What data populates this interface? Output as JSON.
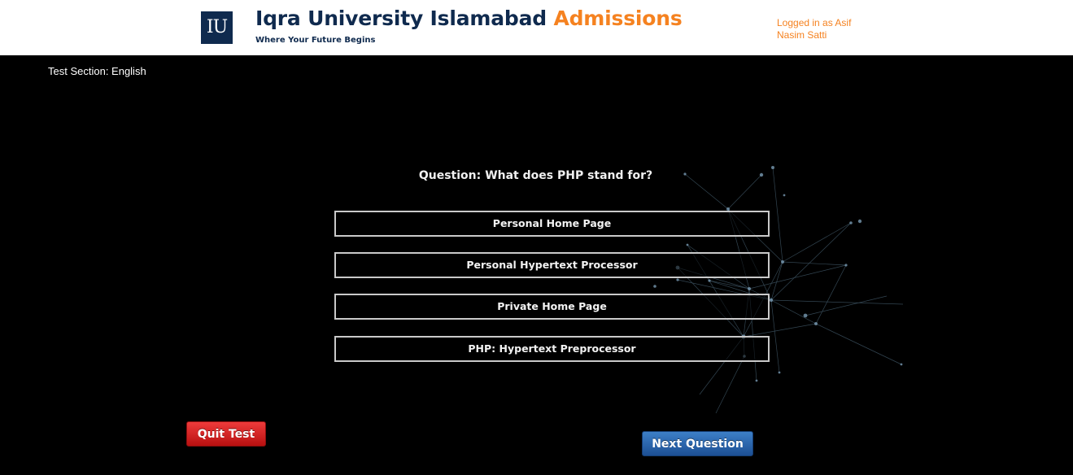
{
  "header": {
    "logo_text": "IU",
    "title_main": "Iqra University Islamabad",
    "title_accent": "Admissions",
    "tagline": "Where Your Future Begins",
    "login_status": "Logged in as Asif Nasim Satti"
  },
  "test": {
    "section_label": "Test Section: English",
    "question_prefix": "Question:",
    "question_text": "What does PHP stand for?",
    "options": [
      "Personal Home Page",
      "Personal Hypertext Processor",
      "Private Home Page",
      "PHP: Hypertext Preprocessor"
    ]
  },
  "buttons": {
    "quit": "Quit Test",
    "next": "Next Question"
  },
  "colors": {
    "brand_navy": "#0f2a4e",
    "brand_orange": "#f58220",
    "quit_red": "#d42020",
    "next_blue": "#2a64ad"
  }
}
